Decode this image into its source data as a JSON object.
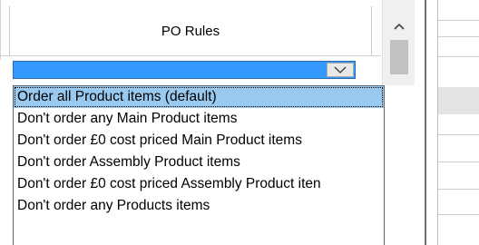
{
  "grid": {
    "column_header": "PO Rules"
  },
  "combo": {
    "value": "",
    "dropdown_icon": "chevron-down-icon"
  },
  "scrollbar": {
    "up_icon": "chevron-up-icon"
  },
  "dropdown": {
    "selected_index": 0,
    "items": [
      {
        "label": "Order all Product items (default)"
      },
      {
        "label": "Don't order any Main Product items"
      },
      {
        "label": "Don't order £0 cost priced Main Product items"
      },
      {
        "label": "Don't order Assembly Product items"
      },
      {
        "label": "Don't order £0 cost priced Assembly Product iten"
      },
      {
        "label": "Don't order any Products items"
      }
    ]
  },
  "colors": {
    "selection_highlight": "#3399ff",
    "item_highlight": "#99c9ef"
  }
}
